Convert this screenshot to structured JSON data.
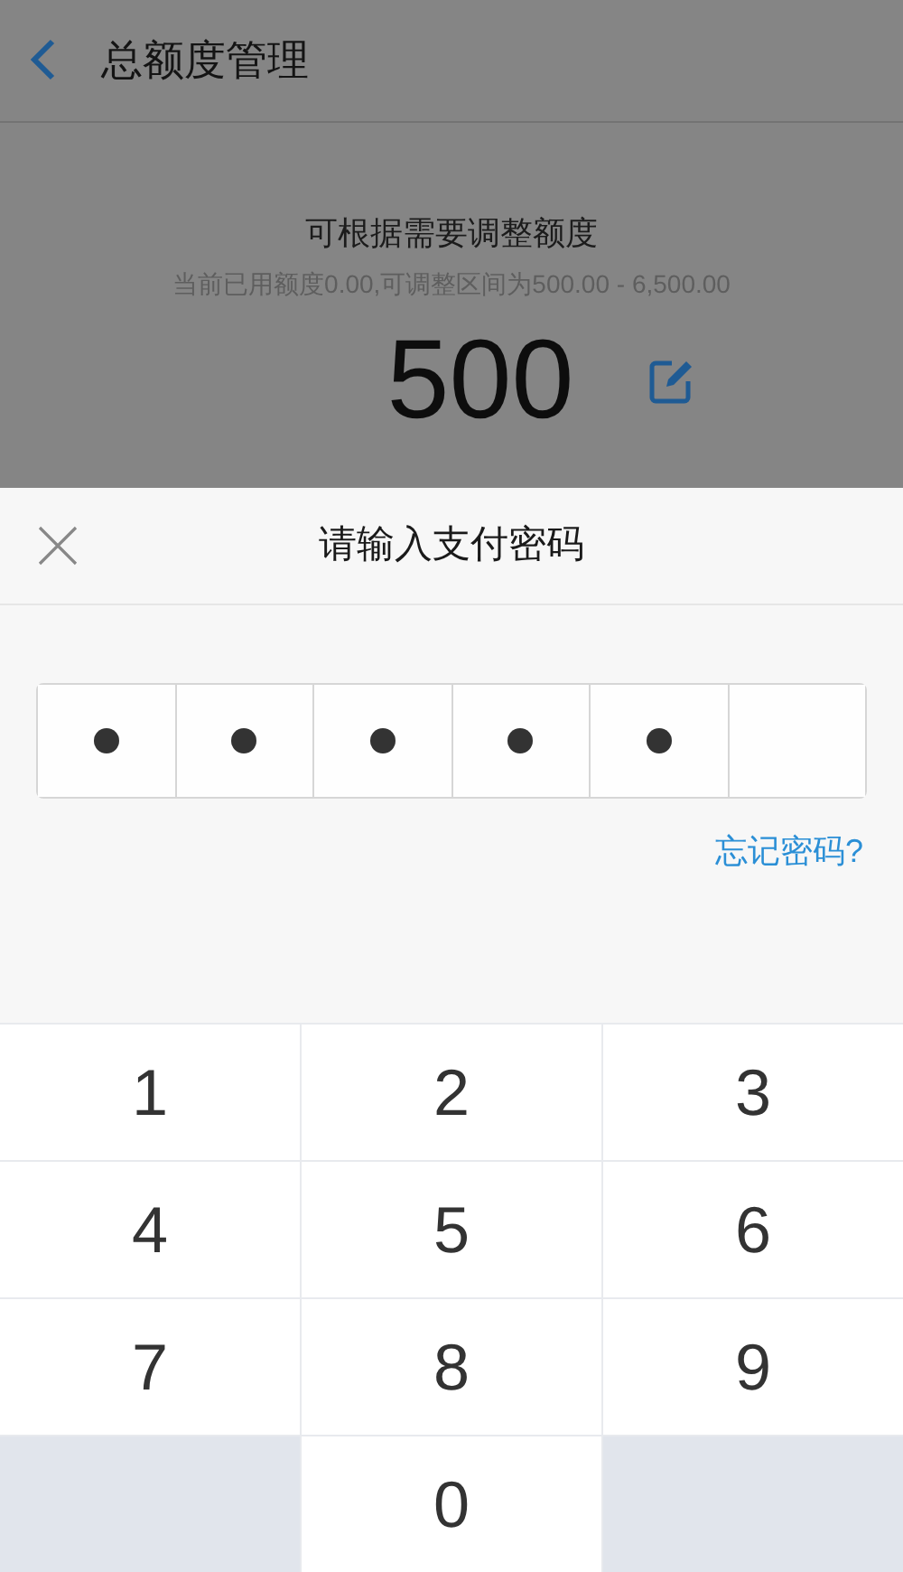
{
  "header": {
    "title": "总额度管理"
  },
  "quota": {
    "heading": "可根据需要调整额度",
    "note": "当前已用额度0.00,可调整区间为500.00 - 6,500.00",
    "amount": "500"
  },
  "dialog": {
    "title": "请输入支付密码",
    "pin": [
      {
        "filled": true
      },
      {
        "filled": true
      },
      {
        "filled": true
      },
      {
        "filled": true
      },
      {
        "filled": true
      },
      {
        "filled": false
      }
    ],
    "forgot_link": "忘记密码?"
  },
  "keypad": [
    {
      "kind": "digit",
      "label": "1"
    },
    {
      "kind": "digit",
      "label": "2"
    },
    {
      "kind": "digit",
      "label": "3"
    },
    {
      "kind": "digit",
      "label": "4"
    },
    {
      "kind": "digit",
      "label": "5"
    },
    {
      "kind": "digit",
      "label": "6"
    },
    {
      "kind": "digit",
      "label": "7"
    },
    {
      "kind": "digit",
      "label": "8"
    },
    {
      "kind": "digit",
      "label": "9"
    },
    {
      "kind": "blank"
    },
    {
      "kind": "digit",
      "label": "0"
    },
    {
      "kind": "blank"
    }
  ]
}
